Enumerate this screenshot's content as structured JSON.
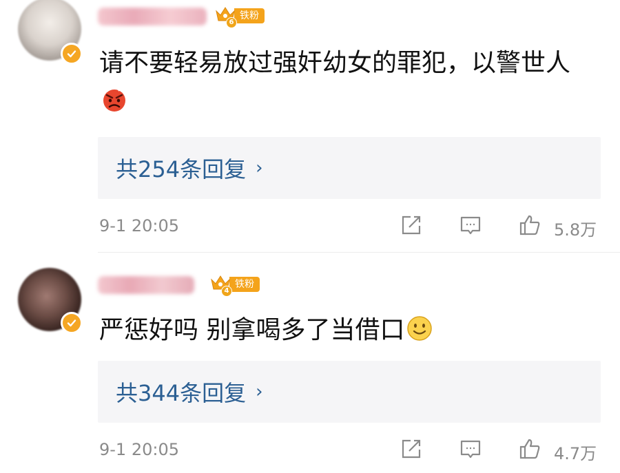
{
  "comments": [
    {
      "fan_badge": {
        "level": "6",
        "label": "铁粉"
      },
      "text": "请不要轻易放过强奸幼女的罪犯，以警世人",
      "emoji": "angry-face",
      "replies": {
        "label": "共254条回复",
        "chevron": "›"
      },
      "time": "9-1 20:05",
      "likes": "5.8万"
    },
    {
      "fan_badge": {
        "level": "4",
        "label": "铁粉"
      },
      "text": "严惩好吗 别拿喝多了当借口",
      "emoji": "smiling-face",
      "replies": {
        "label": "共344条回复",
        "chevron": "›"
      },
      "time": "9-1 20:05",
      "likes": "4.7万"
    }
  ],
  "colors": {
    "reply_link": "#2b5f93",
    "badge": "#f4a31b",
    "meta_text": "#8a8a8a"
  }
}
